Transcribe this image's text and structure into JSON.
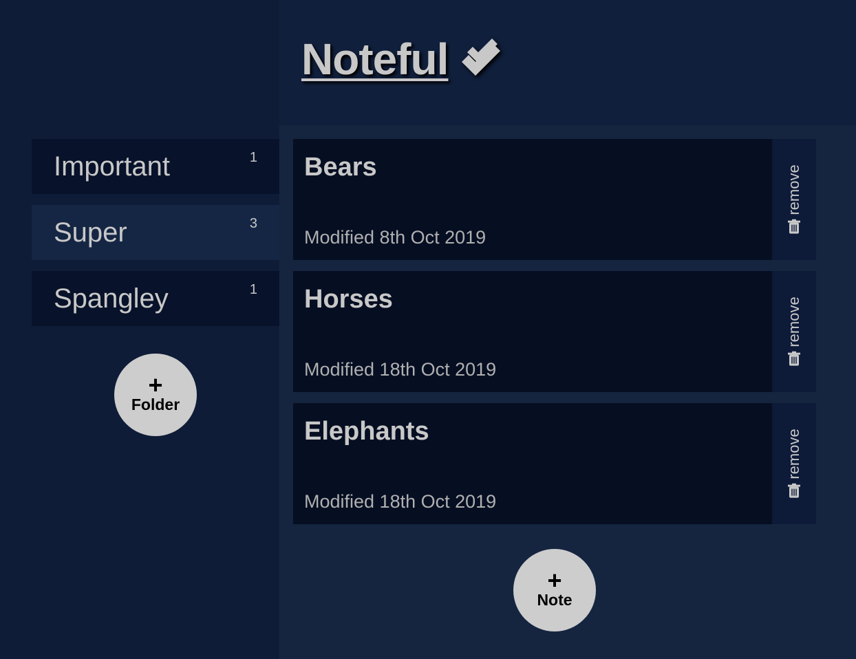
{
  "app": {
    "title": "Noteful"
  },
  "sidebar": {
    "folders": [
      {
        "name": "Important",
        "count": "1",
        "active": false
      },
      {
        "name": "Super",
        "count": "3",
        "active": true
      },
      {
        "name": "Spangley",
        "count": "1",
        "active": false
      }
    ],
    "add_folder": {
      "plus": "+",
      "label": "Folder"
    }
  },
  "notes": [
    {
      "title": "Bears",
      "modified": "Modified 8th Oct 2019",
      "remove_label": "remove"
    },
    {
      "title": "Horses",
      "modified": "Modified 18th Oct 2019",
      "remove_label": "remove"
    },
    {
      "title": "Elephants",
      "modified": "Modified 18th Oct 2019",
      "remove_label": "remove"
    }
  ],
  "add_note": {
    "plus": "+",
    "label": "Note"
  },
  "icons": {
    "title_icon": "check-double-icon",
    "remove_icon": "trash-icon"
  },
  "colors": {
    "background": "#0f1c35",
    "note_background": "#060e22",
    "text": "#c8c8c8",
    "button": "#cdcdcd"
  }
}
